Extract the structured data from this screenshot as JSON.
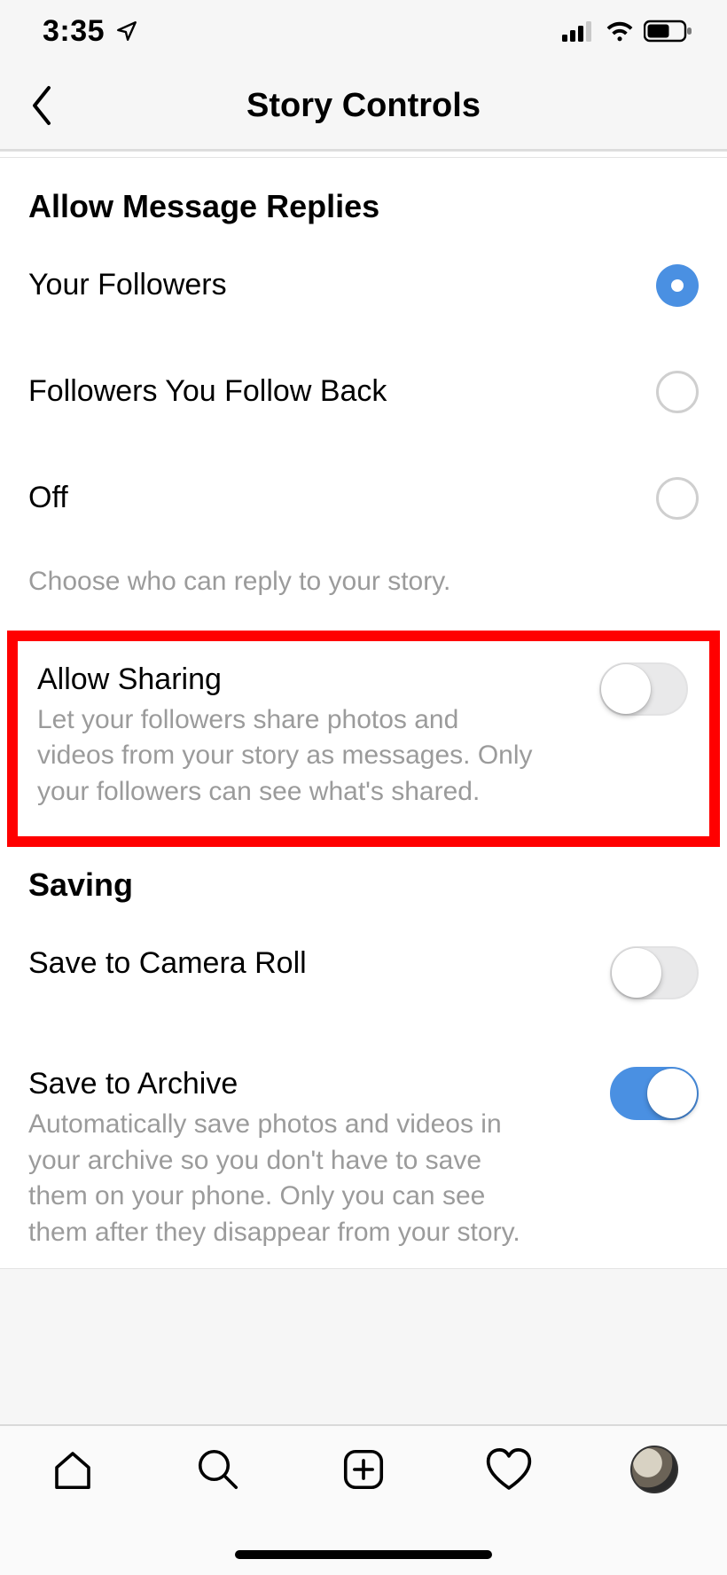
{
  "statusbar": {
    "time": "3:35"
  },
  "header": {
    "title": "Story Controls"
  },
  "sections": {
    "replies": {
      "heading": "Allow Message Replies",
      "options": [
        {
          "label": "Your Followers",
          "selected": true
        },
        {
          "label": "Followers You Follow Back",
          "selected": false
        },
        {
          "label": "Off",
          "selected": false
        }
      ],
      "hint": "Choose who can reply to your story."
    },
    "sharing": {
      "title": "Allow Sharing",
      "desc": "Let your followers share photos and videos from your story as messages. Only your followers can see what's shared.",
      "on": false
    },
    "saving": {
      "heading": "Saving",
      "camera_roll": {
        "title": "Save to Camera Roll",
        "on": false
      },
      "archive": {
        "title": "Save to Archive",
        "desc": "Automatically save photos and videos in your archive so you don't have to save them on your phone. Only you can see them after they disappear from your story.",
        "on": true
      }
    }
  }
}
